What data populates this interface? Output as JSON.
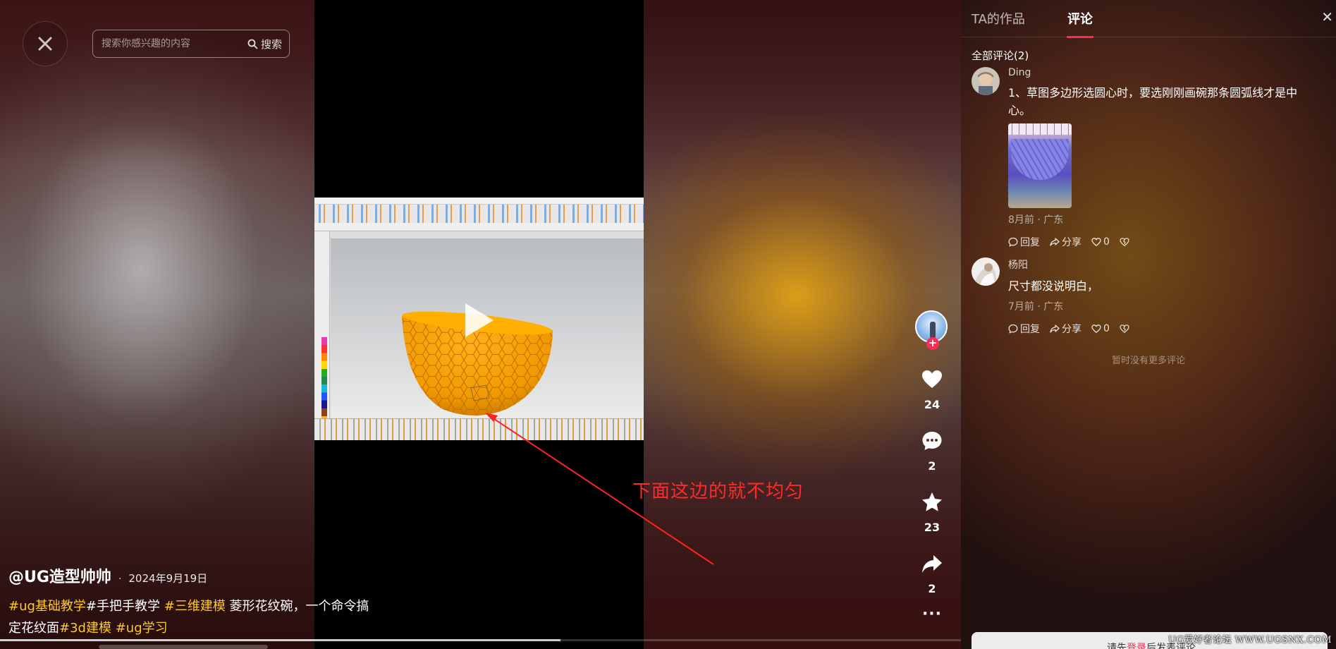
{
  "search": {
    "placeholder": "搜索你感兴趣的内容",
    "button_label": "搜索"
  },
  "video": {
    "annotation": "下面这边的就不均匀",
    "author": "@UG造型帅帅",
    "separator": "·",
    "date": "2024年9月19日",
    "description": {
      "tag1": "#ug基础教学",
      "text1": "#手把手教学 ",
      "tag2": "#三维建模",
      "text2": " 菱形花纹碗，一个命令搞定花纹面",
      "tag3": "#3d建模",
      "tag4": "#ug学习"
    },
    "progress": 0.583
  },
  "actions": {
    "likes": "24",
    "comments": "2",
    "favorites": "23",
    "shares": "2",
    "more": "···"
  },
  "panel": {
    "tabs": [
      {
        "label": "TA的作品"
      },
      {
        "label": "评论"
      }
    ],
    "close": "✕",
    "comments_title": "全部评论(2)",
    "comments": [
      {
        "name": "Ding",
        "text": "1、草图多边形选圆心时，要选刚刚画碗那条圆弧线才是中心。",
        "meta": "8月前 · 广东",
        "reply": "回复",
        "share": "分享",
        "likes": "0"
      },
      {
        "name": "杨阳",
        "text": "尺寸都没说明白，",
        "meta": "7月前 · 广东",
        "reply": "回复",
        "share": "分享",
        "likes": "0"
      }
    ],
    "no_more": "暂时没有更多评论",
    "login_prefix": "请先",
    "login_link": "登录",
    "login_suffix": "后发表评论"
  },
  "watermark": "UG爱好者论坛 WWW.UGSNX.COM",
  "colors": {
    "accent": "#fe2c55",
    "hashtag": "#ffc928",
    "annotation": "#ff2a2a",
    "bowl": "#f5a000"
  }
}
